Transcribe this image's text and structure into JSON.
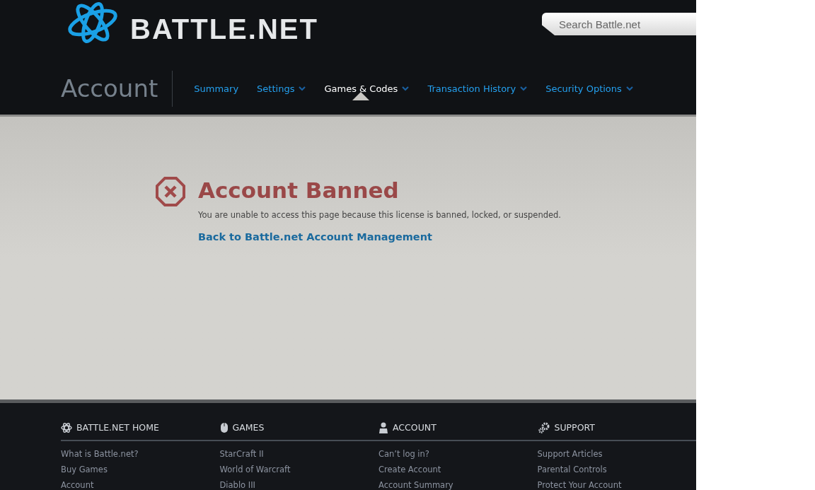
{
  "header": {
    "logo": "BATTLE.NET",
    "search": {
      "placeholder": "Search Battle.net"
    }
  },
  "nav": {
    "title": "Account",
    "items": [
      {
        "label": "Summary",
        "selected": false,
        "dropdown": false
      },
      {
        "label": "Settings",
        "selected": false,
        "dropdown": true
      },
      {
        "label": "Games & Codes",
        "selected": true,
        "dropdown": true
      },
      {
        "label": "Transaction History",
        "selected": false,
        "dropdown": true
      },
      {
        "label": "Security Options",
        "selected": false,
        "dropdown": true
      }
    ]
  },
  "notice": {
    "title": "Account Banned",
    "message": "You are unable to access this page because this license is banned, locked, or suspended.",
    "link": "Back to Battle.net Account Management"
  },
  "footer": {
    "columns": [
      {
        "kind": "home",
        "title": "BATTLE.NET HOME",
        "links": [
          "What is Battle.net?",
          "Buy Games",
          "Account"
        ]
      },
      {
        "kind": "games",
        "title": "GAMES",
        "links": [
          "StarCraft II",
          "World of Warcraft",
          "Diablo III"
        ]
      },
      {
        "kind": "account",
        "title": "ACCOUNT",
        "links": [
          "Can’t log in?",
          "Create Account",
          "Account Summary"
        ]
      },
      {
        "kind": "support",
        "title": "SUPPORT",
        "links": [
          "Support Articles",
          "Parental Controls",
          "Protect Your Account"
        ]
      }
    ]
  }
}
